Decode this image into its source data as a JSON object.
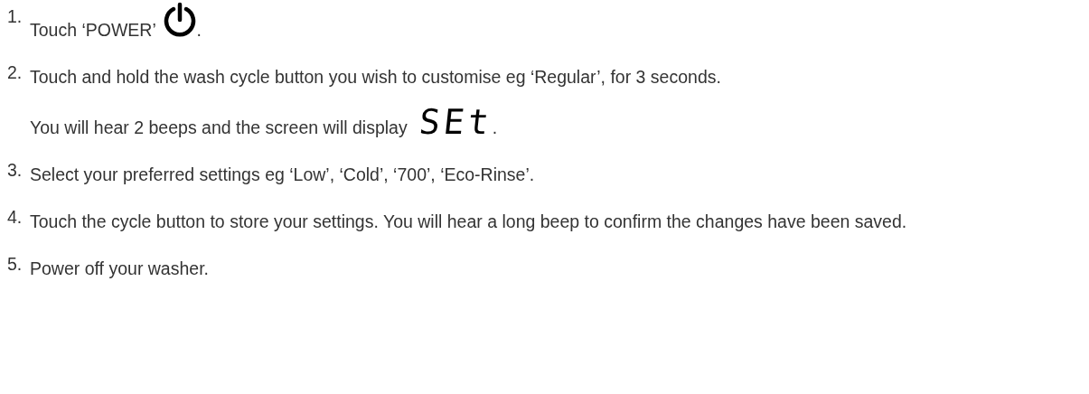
{
  "steps": [
    {
      "number": "1.",
      "paragraphs": [
        {
          "text": "Touch ‘POWER’",
          "icon": {
            "kind": "power"
          },
          "after": "."
        }
      ]
    },
    {
      "number": "2.",
      "paragraphs": [
        {
          "text": "Touch and hold the wash cycle button you wish to customise eg ‘Regular’, for 3 seconds."
        },
        {
          "text": "You will hear 2 beeps and the screen will display",
          "icon": {
            "kind": "display",
            "text": "SEt"
          },
          "after": "."
        }
      ]
    },
    {
      "number": "3.",
      "paragraphs": [
        {
          "text": "Select your preferred settings eg ‘Low’, ‘Cold’, ‘700’, ‘Eco-Rinse’."
        }
      ]
    },
    {
      "number": "4.",
      "paragraphs": [
        {
          "text": "Touch the cycle button to store your settings. You will hear a long beep to confirm the changes have been saved."
        }
      ]
    },
    {
      "number": "5.",
      "paragraphs": [
        {
          "text": "Power off your washer."
        }
      ]
    }
  ]
}
